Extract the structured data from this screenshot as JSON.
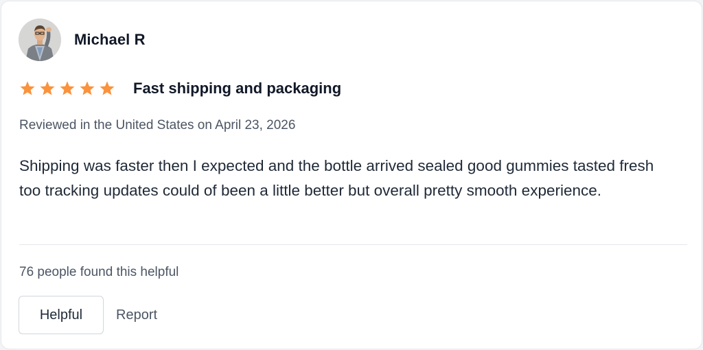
{
  "review": {
    "author": {
      "name": "Michael R",
      "avatar": "avatar-photo"
    },
    "rating": 5,
    "rating_max": 5,
    "star_color": "#fb923c",
    "star_icon": "star-icon",
    "title": "Fast shipping and packaging",
    "meta": "Reviewed in the United States on April 23, 2026",
    "body": "Shipping was faster then I expected and the bottle arrived sealed good gummies tasted fresh too tracking updates could of been a little better but overall pretty smooth experience.",
    "helpful_count_text": "76 people found this helpful",
    "actions": {
      "helpful_label": "Helpful",
      "report_label": "Report"
    }
  }
}
